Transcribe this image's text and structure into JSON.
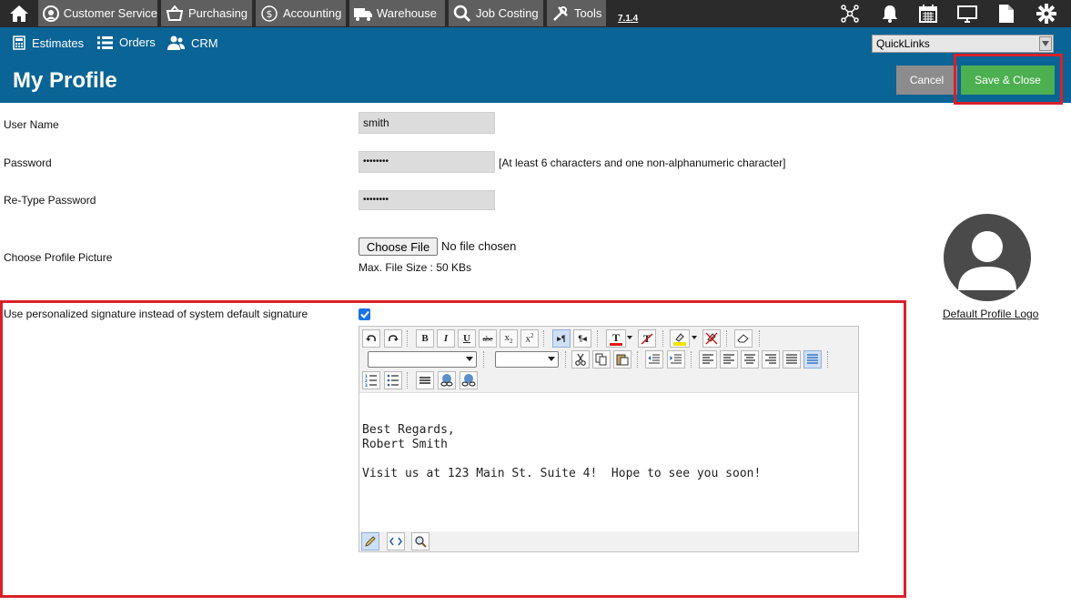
{
  "topnav": {
    "items": [
      {
        "label": "Customer Service",
        "icon": "headset-icon"
      },
      {
        "label": "Purchasing",
        "icon": "basket-icon"
      },
      {
        "label": "Accounting",
        "icon": "dollar-icon"
      },
      {
        "label": "Warehouse",
        "icon": "truck-icon"
      },
      {
        "label": "Job Costing",
        "icon": "magnifier-icon"
      },
      {
        "label": "Tools",
        "icon": "wrench-icon"
      }
    ],
    "version": "7.1.4"
  },
  "subnav": {
    "items": [
      {
        "label": "Estimates",
        "icon": "calculator-icon"
      },
      {
        "label": "Orders",
        "icon": "list-icon"
      },
      {
        "label": "CRM",
        "icon": "users-icon"
      }
    ],
    "quicklinks": "QuickLinks"
  },
  "page": {
    "title": "My Profile",
    "cancel": "Cancel",
    "save_close": "Save & Close"
  },
  "form": {
    "username_label": "User Name",
    "username_value": "smith",
    "password_label": "Password",
    "password_value": "••••••••",
    "password_hint": "[At least 6 characters and one non-alphanumeric character]",
    "retype_label": "Re-Type Password",
    "retype_value": "••••••••",
    "picture_label": "Choose Profile Picture",
    "choose_file": "Choose File",
    "no_file": "No file chosen",
    "max_size": "Max. File Size : 50 KBs",
    "default_logo": "Default Profile Logo",
    "signature_label": "Use personalized signature instead of system default signature",
    "signature_checked": true
  },
  "editor": {
    "lines": [
      "Best Regards,",
      "Robert Smith",
      "",
      "Visit us at 123 Main St. Suite 4!  Hope to see you soon!"
    ]
  }
}
